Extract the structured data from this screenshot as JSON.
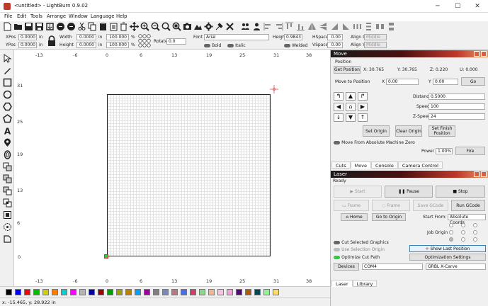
{
  "window": {
    "title": "<untitled> - LightBurn 0.9.02",
    "minimize": "─",
    "maximize": "☐",
    "close": "✕"
  },
  "menu": [
    "File",
    "Edit",
    "Tools",
    "Arrange",
    "Window",
    "Language",
    "Help"
  ],
  "toolbar2": {
    "xpos_label": "XPos",
    "xpos_value": "0.0000",
    "ypos_label": "YPos",
    "ypos_value": "0.0000",
    "unit": "in",
    "width_label": "Width",
    "width_value": "0.0000",
    "height_label": "Height",
    "height_value": "0.0000",
    "pct_w": "100.000",
    "pct_h": "100.000",
    "pct": "%",
    "rotate_label": "Rotate",
    "rotate_value": "0.0",
    "font_label": "Font",
    "font_value": "Arial",
    "fheight_label": "Height",
    "fheight_value": "0.9843",
    "hspace_label": "HSpace",
    "hspace_value": "0.00",
    "vspace_label": "VSpace",
    "vspace_value": "0.00",
    "alignx_label": "Align X",
    "alignx_value": "Middle",
    "aligny_label": "Align Y",
    "aligny_value": "Middle",
    "bold": "Bold",
    "italic": "Italic",
    "welded": "Welded"
  },
  "rulers": {
    "top": [
      "-13",
      "-6",
      "0",
      "6",
      "13",
      "19",
      "25",
      "31",
      "38"
    ],
    "bottom": [
      "-13",
      "-6",
      "0",
      "6",
      "13",
      "19",
      "25",
      "31",
      "38"
    ],
    "left": [
      "31",
      "25",
      "19",
      "13",
      "6",
      "0"
    ]
  },
  "move_panel": {
    "title": "Move",
    "position_label": "Position",
    "get_position": "Get Position",
    "x_readout": "X: 30.765",
    "y_readout": "Y: 30.765",
    "z_readout": "Z: 0.220",
    "u_readout": "U: 0.000",
    "move_to_position": "Move to Position",
    "x_label": "X",
    "x_value": "0.00",
    "y_label": "Y",
    "y_value": "0.00",
    "go": "Go",
    "distance_label": "Distance",
    "distance_value": "0.5000",
    "speed_label": "Speed",
    "speed_value": "100",
    "zspeed_label": "Z-Speed",
    "zspeed_value": "24",
    "set_origin": "Set Origin",
    "clear_origin": "Clear Origin",
    "set_finish": "Set Finish Position",
    "move_from_abs": "Move From Absolute Machine Zero",
    "power_label": "Power",
    "power_value": "1.00%",
    "fire": "Fire"
  },
  "tabs_top": [
    "Cuts",
    "Move",
    "Console",
    "Camera Control"
  ],
  "laser_panel": {
    "title": "Laser",
    "status": "Ready",
    "start": "Start",
    "pause": "Pause",
    "stop": "Stop",
    "frame1": "Frame",
    "frame2": "Frame",
    "save_gcode": "Save GCode",
    "run_gcode": "Run GCode",
    "home": "Home",
    "go_to_origin": "Go to Origin",
    "start_from_label": "Start From:",
    "start_from_value": "Absolute Coords",
    "job_origin": "Job Origin",
    "cut_selected": "Cut Selected Graphics",
    "use_selection_origin": "Use Selection Origin",
    "optimize_cut_path": "Optimize Cut Path",
    "show_last_position": "Show Last Position",
    "optimization_settings": "Optimization Settings",
    "devices": "Devices",
    "port": "COM4",
    "device": "GRBL X-Carve"
  },
  "tabs_bottom": [
    "Laser",
    "Library"
  ],
  "palette_colors": [
    "#000000",
    "#0000ff",
    "#ff0000",
    "#00c000",
    "#d0d000",
    "#ff8000",
    "#00d0d0",
    "#ff00ff",
    "#b4b4b4",
    "#0000a0",
    "#a00000",
    "#00a000",
    "#a0a000",
    "#c08000",
    "#00a0ff",
    "#a000a0",
    "#808080",
    "#7d87b9",
    "#bb7784",
    "#4a6fe3",
    "#d33f6a",
    "#8cd78c",
    "#f0b98d",
    "#f6c4e1",
    "#fa9ed4",
    "#500a78",
    "#b45a00",
    "#004754",
    "#86fa88",
    "#ffdb66"
  ],
  "status_text": "x: -15.465, y: 28.922 in"
}
